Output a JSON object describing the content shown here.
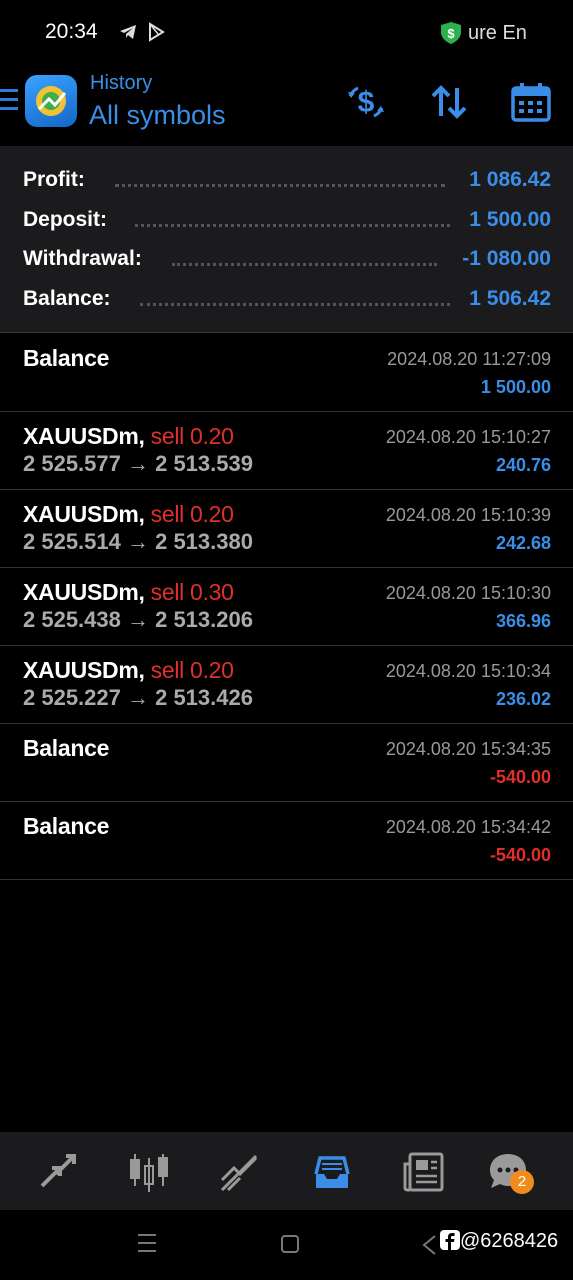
{
  "status_bar": {
    "time": "20:34",
    "vpn_text": "ure En"
  },
  "header": {
    "subtitle": "History",
    "title": "All symbols"
  },
  "summary": [
    {
      "label": "Profit:",
      "value": "1 086.42"
    },
    {
      "label": "Deposit:",
      "value": "1 500.00"
    },
    {
      "label": "Withdrawal:",
      "value": "-1 080.00"
    },
    {
      "label": "Balance:",
      "value": "1 506.42"
    }
  ],
  "deals": [
    {
      "kind": "balance",
      "title": "Balance",
      "time": "2024.08.20 11:27:09",
      "amount": "1 500.00",
      "sign": "pos"
    },
    {
      "kind": "trade",
      "symbol": "XAUUSDm,",
      "side": "sell 0.20",
      "prices": "2 525.577 → 2 513.539",
      "time": "2024.08.20 15:10:27",
      "amount": "240.76",
      "sign": "pos"
    },
    {
      "kind": "trade",
      "symbol": "XAUUSDm,",
      "side": "sell 0.20",
      "prices": "2 525.514 → 2 513.380",
      "time": "2024.08.20 15:10:39",
      "amount": "242.68",
      "sign": "pos"
    },
    {
      "kind": "trade",
      "symbol": "XAUUSDm,",
      "side": "sell 0.30",
      "prices": "2 525.438 → 2 513.206",
      "time": "2024.08.20 15:10:30",
      "amount": "366.96",
      "sign": "pos"
    },
    {
      "kind": "trade",
      "symbol": "XAUUSDm,",
      "side": "sell 0.20",
      "prices": "2 525.227 → 2 513.426",
      "time": "2024.08.20 15:10:34",
      "amount": "236.02",
      "sign": "pos"
    },
    {
      "kind": "balance",
      "title": "Balance",
      "time": "2024.08.20 15:34:35",
      "amount": "-540.00",
      "sign": "neg"
    },
    {
      "kind": "balance",
      "title": "Balance",
      "time": "2024.08.20 15:34:42",
      "amount": "-540.00",
      "sign": "neg"
    }
  ],
  "bottom_nav": {
    "items": [
      "quotes-icon",
      "chart-icon",
      "trade-icon",
      "history-icon",
      "news-icon",
      "chat-icon"
    ],
    "active": "history-icon",
    "chat_badge": "2"
  },
  "watermark": "@6268426",
  "colors": {
    "accent": "#3a8ee8",
    "negative": "#e0302a",
    "badge": "#f08c1e"
  }
}
